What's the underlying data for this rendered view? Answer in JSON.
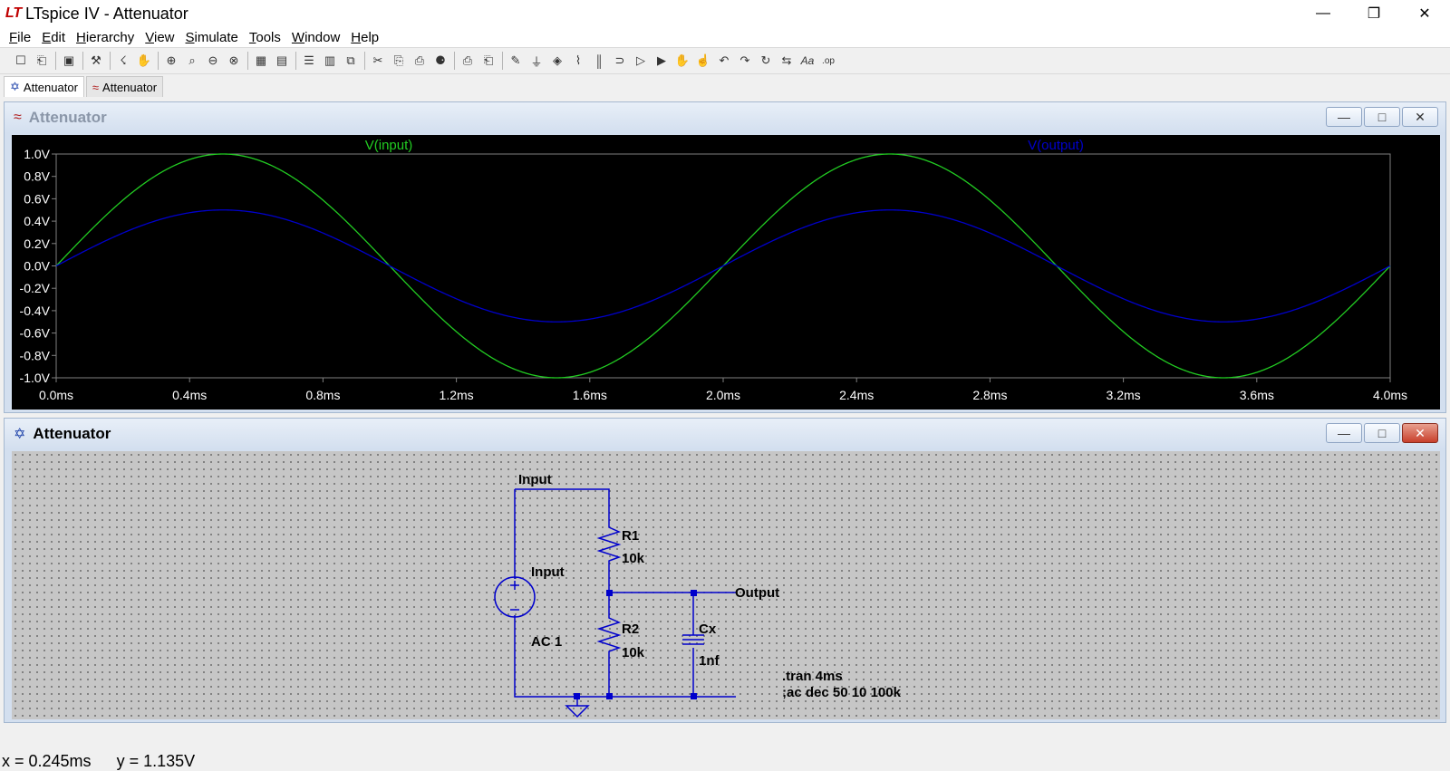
{
  "app": {
    "logo": "LT",
    "title": "LTspice IV - Attenuator"
  },
  "window_controls": {
    "minimize": "—",
    "maximize": "❐",
    "close": "✕"
  },
  "menu": [
    "File",
    "Edit",
    "Hierarchy",
    "View",
    "Simulate",
    "Tools",
    "Window",
    "Help"
  ],
  "toolbar": {
    "icons": [
      "new-schematic-icon",
      "open-icon",
      "|",
      "save-icon",
      "|",
      "control-panel-icon",
      "|",
      "run-icon",
      "halt-icon",
      "|",
      "zoom-in-icon",
      "zoom-pan-icon",
      "zoom-out-icon",
      "zoom-cancel-icon",
      "|",
      "autorange-icon",
      "add-plot-pane-icon",
      "|",
      "tile-horizontal-icon",
      "tile-vertical-icon",
      "cascade-icon",
      "|",
      "cut-icon",
      "copy-icon",
      "paste-icon",
      "find-icon",
      "|",
      "print-icon",
      "print-setup-icon",
      "|",
      "wire-icon",
      "ground-icon",
      "label-net-icon",
      "resistor-icon",
      "capacitor-icon",
      "inductor-icon",
      "diode-icon",
      "component-icon",
      "move-icon",
      "drag-icon",
      "undo-icon",
      "redo-icon",
      "rotate-icon",
      "mirror-icon",
      "text-icon",
      "spice-directive-icon"
    ]
  },
  "tabs": [
    {
      "label": "Attenuator",
      "icon": "schematic-icon",
      "active": true
    },
    {
      "label": "Attenuator",
      "icon": "waveform-icon",
      "active": false
    }
  ],
  "plot_window": {
    "title": "Attenuator",
    "icon": "waveform-icon",
    "colors": {
      "background": "#000000",
      "input": "#22cc22",
      "output": "#0000cc",
      "axis": "#808080",
      "label": "#ffffff"
    }
  },
  "chart_data": {
    "type": "line",
    "xlabel": "",
    "ylabel": "",
    "xlim": [
      0,
      4
    ],
    "ylim": [
      -1,
      1
    ],
    "x_ticks": [
      "0.0ms",
      "0.4ms",
      "0.8ms",
      "1.2ms",
      "1.6ms",
      "2.0ms",
      "2.4ms",
      "2.8ms",
      "3.2ms",
      "3.6ms",
      "4.0ms"
    ],
    "y_ticks": [
      "1.0V",
      "0.8V",
      "0.6V",
      "0.4V",
      "0.2V",
      "0.0V",
      "-0.2V",
      "-0.4V",
      "-0.6V",
      "-0.8V",
      "-1.0V"
    ],
    "series": [
      {
        "name": "V(input)",
        "color": "#22cc22",
        "amplitude": 1.0,
        "frequency_khz": 0.5
      },
      {
        "name": "V(output)",
        "color": "#0000cc",
        "amplitude": 0.5,
        "frequency_khz": 0.5
      }
    ]
  },
  "schematic_window": {
    "title": "Attenuator",
    "icon": "schematic-icon",
    "labels": {
      "input_net": "Input",
      "source_name": "Input",
      "source_value": "AC 1",
      "r1_name": "R1",
      "r1_value": "10k",
      "r2_name": "R2",
      "r2_value": "10k",
      "cx_name": "Cx",
      "cx_value": "1nf",
      "output_net": "Output",
      "directive1": ".tran 4ms",
      "directive2": ";ac dec 50 10 100k"
    }
  },
  "status": {
    "x": "x = 0.245ms",
    "y": "y = 1.135V"
  }
}
